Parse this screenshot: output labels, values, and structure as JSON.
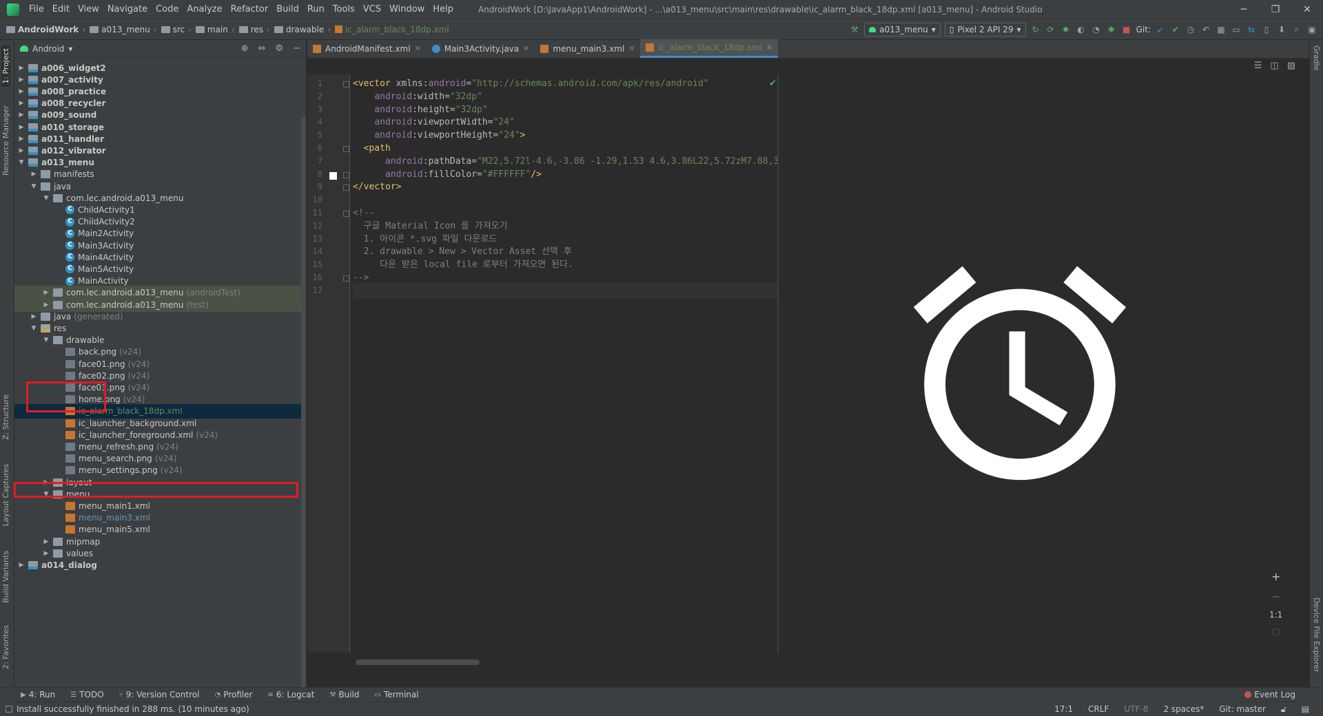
{
  "menubar": {
    "items": [
      "File",
      "Edit",
      "View",
      "Navigate",
      "Code",
      "Analyze",
      "Refactor",
      "Build",
      "Run",
      "Tools",
      "VCS",
      "Window",
      "Help"
    ],
    "window_title": "AndroidWork [D:\\JavaApp1\\AndroidWork] - ...\\a013_menu\\src\\main\\res\\drawable\\ic_alarm_black_18dp.xml [a013_menu] - Android Studio"
  },
  "breadcrumb": {
    "items": [
      "AndroidWork",
      "a013_menu",
      "src",
      "main",
      "res",
      "drawable",
      "ic_alarm_black_18dp.xml"
    ]
  },
  "toolbar": {
    "run_config": "a013_menu",
    "device": "Pixel 2 API 29",
    "git_label": "Git:"
  },
  "left_stripe": {
    "tabs": [
      "1: Project",
      "Resource Manager",
      "Z: Structure",
      "Layout Captures",
      "Build Variants",
      "2: Favorites"
    ]
  },
  "right_stripe": {
    "tabs": [
      "Gradle",
      "Device File Explorer"
    ]
  },
  "project_panel": {
    "view_label": "Android",
    "tree": [
      {
        "label": "a006_widget2",
        "level": 0,
        "arrow": "collapsed",
        "icon": "module-folder",
        "bold": true
      },
      {
        "label": "a007_activity",
        "level": 0,
        "arrow": "collapsed",
        "icon": "module-folder",
        "bold": true
      },
      {
        "label": "a008_practice",
        "level": 0,
        "arrow": "collapsed",
        "icon": "module-folder",
        "bold": true
      },
      {
        "label": "a008_recycler",
        "level": 0,
        "arrow": "collapsed",
        "icon": "module-folder",
        "bold": true
      },
      {
        "label": "a009_sound",
        "level": 0,
        "arrow": "collapsed",
        "icon": "module-folder",
        "bold": true
      },
      {
        "label": "a010_storage",
        "level": 0,
        "arrow": "collapsed",
        "icon": "module-folder",
        "bold": true
      },
      {
        "label": "a011_handler",
        "level": 0,
        "arrow": "collapsed",
        "icon": "module-folder",
        "bold": true
      },
      {
        "label": "a012_vibrator",
        "level": 0,
        "arrow": "collapsed",
        "icon": "module-folder",
        "bold": true
      },
      {
        "label": "a013_menu",
        "level": 0,
        "arrow": "expanded",
        "icon": "module-folder",
        "bold": true
      },
      {
        "label": "manifests",
        "level": 1,
        "arrow": "collapsed",
        "icon": "folder"
      },
      {
        "label": "java",
        "level": 1,
        "arrow": "expanded",
        "icon": "folder"
      },
      {
        "label": "com.lec.android.a013_menu",
        "level": 2,
        "arrow": "expanded",
        "icon": "folder"
      },
      {
        "label": "ChildActivity1",
        "level": 3,
        "arrow": "none",
        "icon": "class"
      },
      {
        "label": "ChildActivity2",
        "level": 3,
        "arrow": "none",
        "icon": "class"
      },
      {
        "label": "Main2Activity",
        "level": 3,
        "arrow": "none",
        "icon": "class"
      },
      {
        "label": "Main3Activity",
        "level": 3,
        "arrow": "none",
        "icon": "class"
      },
      {
        "label": "Main4Activity",
        "level": 3,
        "arrow": "none",
        "icon": "class"
      },
      {
        "label": "Main5Activity",
        "level": 3,
        "arrow": "none",
        "icon": "class"
      },
      {
        "label": "MainActivity",
        "level": 3,
        "arrow": "none",
        "icon": "class"
      },
      {
        "label": "com.lec.android.a013_menu",
        "suffix": "(androidTest)",
        "level": 2,
        "arrow": "collapsed",
        "icon": "folder",
        "highlight": "test"
      },
      {
        "label": "com.lec.android.a013_menu",
        "suffix": "(test)",
        "level": 2,
        "arrow": "collapsed",
        "icon": "folder",
        "highlight": "test"
      },
      {
        "label": "java",
        "suffix": "(generated)",
        "level": 1,
        "arrow": "collapsed",
        "icon": "folder"
      },
      {
        "label": "res",
        "level": 1,
        "arrow": "expanded",
        "icon": "res-folder"
      },
      {
        "label": "drawable",
        "level": 2,
        "arrow": "expanded",
        "icon": "folder"
      },
      {
        "label": "back.png",
        "suffix": "(v24)",
        "level": 3,
        "arrow": "none",
        "icon": "png"
      },
      {
        "label": "face01.png",
        "suffix": "(v24)",
        "level": 3,
        "arrow": "none",
        "icon": "png"
      },
      {
        "label": "face02.png",
        "suffix": "(v24)",
        "level": 3,
        "arrow": "none",
        "icon": "png"
      },
      {
        "label": "face03.png",
        "suffix": "(v24)",
        "level": 3,
        "arrow": "none",
        "icon": "png"
      },
      {
        "label": "home.png",
        "suffix": "(v24)",
        "level": 3,
        "arrow": "none",
        "icon": "png"
      },
      {
        "label": "ic_alarm_black_18dp.xml",
        "level": 3,
        "arrow": "none",
        "icon": "xml",
        "selected": true
      },
      {
        "label": "ic_launcher_background.xml",
        "level": 3,
        "arrow": "none",
        "icon": "xml"
      },
      {
        "label": "ic_launcher_foreground.xml",
        "suffix": "(v24)",
        "level": 3,
        "arrow": "none",
        "icon": "xml"
      },
      {
        "label": "menu_refresh.png",
        "suffix": "(v24)",
        "level": 3,
        "arrow": "none",
        "icon": "png"
      },
      {
        "label": "menu_search.png",
        "suffix": "(v24)",
        "level": 3,
        "arrow": "none",
        "icon": "png"
      },
      {
        "label": "menu_settings.png",
        "suffix": "(v24)",
        "level": 3,
        "arrow": "none",
        "icon": "png"
      },
      {
        "label": "layout",
        "level": 2,
        "arrow": "collapsed",
        "icon": "folder"
      },
      {
        "label": "menu",
        "level": 2,
        "arrow": "expanded",
        "icon": "folder"
      },
      {
        "label": "menu_main1.xml",
        "level": 3,
        "arrow": "none",
        "icon": "xml"
      },
      {
        "label": "menu_main3.xml",
        "level": 3,
        "arrow": "none",
        "icon": "xml",
        "link": true
      },
      {
        "label": "menu_main5.xml",
        "level": 3,
        "arrow": "none",
        "icon": "xml"
      },
      {
        "label": "mipmap",
        "level": 2,
        "arrow": "collapsed",
        "icon": "folder"
      },
      {
        "label": "values",
        "level": 2,
        "arrow": "collapsed",
        "icon": "folder"
      },
      {
        "label": "a014_dialog",
        "level": 0,
        "arrow": "collapsed",
        "icon": "module-folder",
        "bold": true
      }
    ]
  },
  "editor": {
    "tabs": [
      {
        "label": "AndroidManifest.xml",
        "icon": "xml",
        "active": false
      },
      {
        "label": "Main3Activity.java",
        "icon": "class",
        "active": false
      },
      {
        "label": "menu_main3.xml",
        "icon": "xml",
        "active": false
      },
      {
        "label": "ic_alarm_black_18dp.xml",
        "icon": "xml",
        "active": true
      }
    ],
    "line_numbers": [
      "1",
      "2",
      "3",
      "4",
      "5",
      "6",
      "7",
      "8",
      "9",
      "10",
      "11",
      "12",
      "13",
      "14",
      "15",
      "16",
      "17"
    ],
    "code_lines": [
      [
        {
          "t": "<",
          "c": "tag"
        },
        {
          "t": "vector ",
          "c": "tag"
        },
        {
          "t": "xmlns:",
          "c": "attr"
        },
        {
          "t": "android",
          "c": "ns"
        },
        {
          "t": "=",
          "c": "attr"
        },
        {
          "t": "\"http://schemas.android.com/apk/res/android\"",
          "c": "val"
        }
      ],
      [
        {
          "t": "    ",
          "c": "attr"
        },
        {
          "t": "android",
          "c": "ns"
        },
        {
          "t": ":width=",
          "c": "attr"
        },
        {
          "t": "\"32dp\"",
          "c": "val"
        }
      ],
      [
        {
          "t": "    ",
          "c": "attr"
        },
        {
          "t": "android",
          "c": "ns"
        },
        {
          "t": ":height=",
          "c": "attr"
        },
        {
          "t": "\"32dp\"",
          "c": "val"
        }
      ],
      [
        {
          "t": "    ",
          "c": "attr"
        },
        {
          "t": "android",
          "c": "ns"
        },
        {
          "t": ":viewportWidth=",
          "c": "attr"
        },
        {
          "t": "\"24\"",
          "c": "val"
        }
      ],
      [
        {
          "t": "    ",
          "c": "attr"
        },
        {
          "t": "android",
          "c": "ns"
        },
        {
          "t": ":viewportHeight=",
          "c": "attr"
        },
        {
          "t": "\"24\"",
          "c": "val"
        },
        {
          "t": ">",
          "c": "tag"
        }
      ],
      [
        {
          "t": "  ",
          "c": "attr"
        },
        {
          "t": "<path",
          "c": "tag"
        }
      ],
      [
        {
          "t": "      ",
          "c": "attr"
        },
        {
          "t": "android",
          "c": "ns"
        },
        {
          "t": ":pathData=",
          "c": "attr"
        },
        {
          "t": "\"M22,5.72l-4.6,-3.86 -1.29,1.53 4.6,3.86L22,5.72zM7.88,3.",
          "c": "val"
        }
      ],
      [
        {
          "t": "      ",
          "c": "attr"
        },
        {
          "t": "android",
          "c": "ns"
        },
        {
          "t": ":fillColor=",
          "c": "attr"
        },
        {
          "t": "\"#FFFFFF\"",
          "c": "val"
        },
        {
          "t": "/>",
          "c": "tag"
        }
      ],
      [
        {
          "t": "</vector>",
          "c": "tag"
        }
      ],
      [],
      [
        {
          "t": "<!--",
          "c": "comment"
        }
      ],
      [
        {
          "t": "  구글 Material Icon 을 가져오기",
          "c": "comment"
        }
      ],
      [
        {
          "t": "  1. 아이콘 *.svg 파일 다운로드",
          "c": "comment"
        }
      ],
      [
        {
          "t": "  2. drawable > New > Vector Asset 선택 후",
          "c": "comment"
        }
      ],
      [
        {
          "t": "     다운 받은 local file 로부터 가져오면 된다.",
          "c": "comment"
        }
      ],
      [
        {
          "t": "-->",
          "c": "comment"
        }
      ],
      []
    ],
    "current_line": 17,
    "fill_color": "#FFFFFF"
  },
  "preview": {
    "zoom_label": "1:1"
  },
  "bottom_tools": [
    {
      "label": "4: Run",
      "icon": "play-icon"
    },
    {
      "label": "TODO",
      "icon": "list-icon"
    },
    {
      "label": "9: Version Control",
      "icon": "vcs-icon"
    },
    {
      "label": "Profiler",
      "icon": "gauge-icon"
    },
    {
      "label": "6: Logcat",
      "icon": "logcat-icon"
    },
    {
      "label": "Build",
      "icon": "hammer-icon"
    },
    {
      "label": "Terminal",
      "icon": "terminal-icon"
    }
  ],
  "event_log": "Event Log",
  "status_bar": {
    "message": "Install successfully finished in 288 ms. (10 minutes ago)",
    "position": "17:1",
    "line_separator": "CRLF",
    "encoding": "UTF-8",
    "indent": "2 spaces*",
    "git_branch": "Git: master"
  },
  "colors": {
    "annotation_red": "#e31b23",
    "selection_blue": "#0d293e",
    "test_green": "#4a5246"
  }
}
